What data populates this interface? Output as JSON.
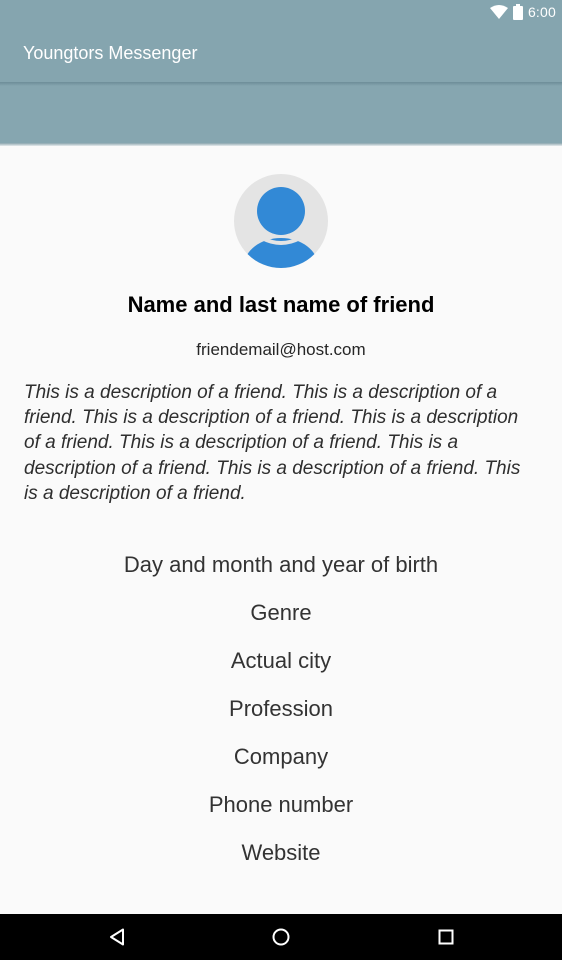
{
  "status_bar": {
    "time": "6:00",
    "icons": [
      "wifi-icon",
      "battery-icon"
    ]
  },
  "toolbar": {
    "title": "Youngtors Messenger"
  },
  "profile": {
    "avatar_icon": "person-icon",
    "name": "Name and last name of friend",
    "email": "friendemail@host.com",
    "description": "This is a description of a friend. This is a description of a friend. This is a description of a friend. This is a description of a friend. This is a description of a friend. This is a description of a friend. This is a description of a friend. This is a description of a friend.",
    "fields": {
      "birth_date": "Day and month and year of birth",
      "genre": "Genre",
      "city": "Actual city",
      "profession": "Profession",
      "company": "Company",
      "phone": "Phone number",
      "website": "Website"
    }
  },
  "nav_bar": {
    "buttons": [
      "back-icon",
      "home-icon",
      "recents-icon"
    ]
  },
  "colors": {
    "toolbar": "#85a5af",
    "avatar_bg": "#e4e4e4",
    "avatar_fg": "#3289d6",
    "background": "#fafafa",
    "nav_bar": "#000000"
  }
}
